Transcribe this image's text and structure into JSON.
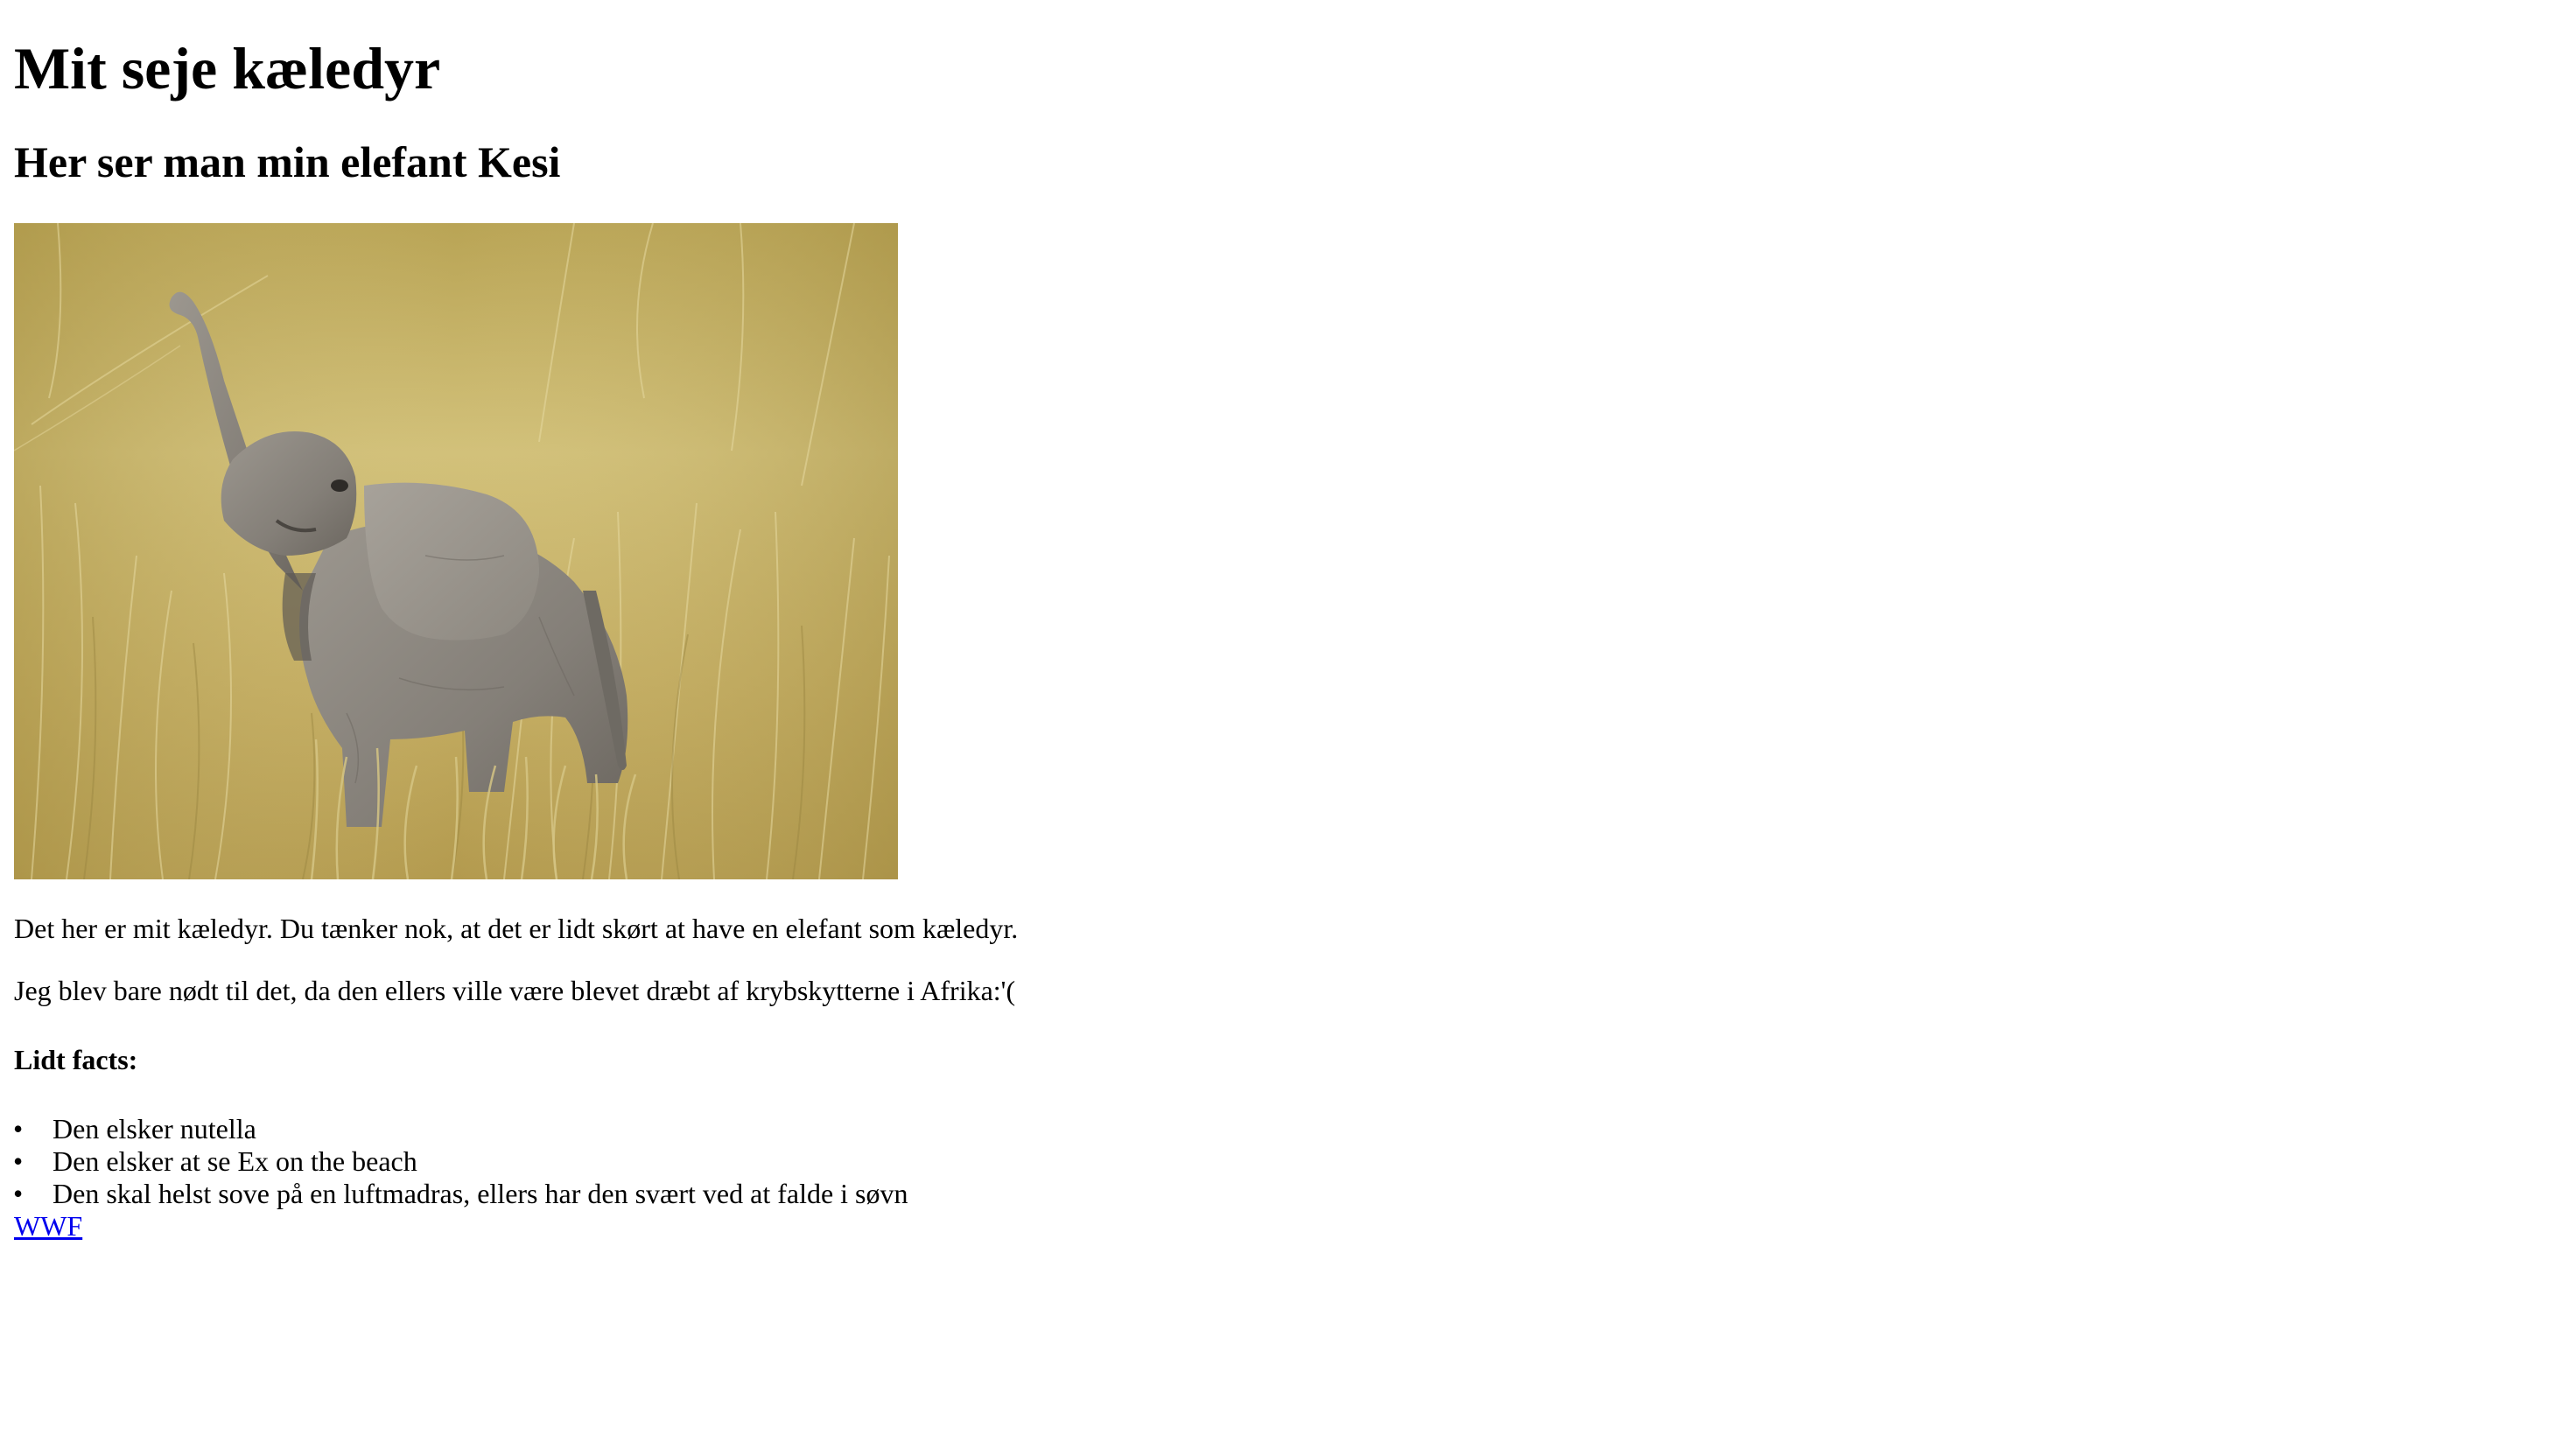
{
  "page": {
    "heading": "Mit seje kæledyr",
    "subheading": "Her ser man min elefant Kesi",
    "paragraph_1": "Det her er mit kæledyr. Du tænker nok, at det er lidt skørt at have en elefant som kæledyr.",
    "paragraph_2": "Jeg blev bare nødt til det, da den ellers ville være blevet dræbt af krybskytterne i Afrika:'(",
    "facts_heading": "Lidt facts:",
    "facts": [
      "Den elsker nutella",
      "Den elsker at se Ex on the beach",
      "Den skal helst sove på en luftmadras, ellers har den svært ved at falde i søvn"
    ],
    "link_label": "WWF"
  },
  "image": {
    "subject": "baby-elephant-in-tall-grass"
  },
  "colors": {
    "link": "#0000ee",
    "text": "#000000",
    "grass": "#c8b46a",
    "elephant": "#8a8680"
  }
}
